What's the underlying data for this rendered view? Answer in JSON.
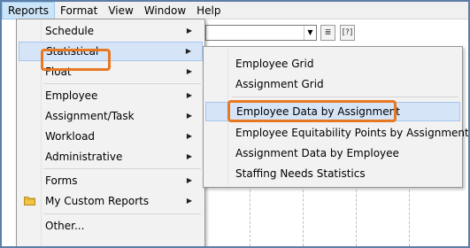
{
  "menubar": {
    "items": [
      "Reports",
      "Format",
      "View",
      "Window",
      "Help"
    ]
  },
  "reports_menu": {
    "items": [
      {
        "label": "Schedule",
        "submenu": true
      },
      {
        "label": "Statistical",
        "submenu": true
      },
      {
        "label": "Float",
        "submenu": true
      },
      {
        "label": "Employee",
        "submenu": true
      },
      {
        "label": "Assignment/Task",
        "submenu": true
      },
      {
        "label": "Workload",
        "submenu": true
      },
      {
        "label": "Administrative",
        "submenu": true
      },
      {
        "label": "Forms",
        "submenu": true
      },
      {
        "label": "My Custom Reports",
        "submenu": true,
        "icon": "folder-icon"
      },
      {
        "label": "Other...",
        "submenu": false
      }
    ],
    "selected": "Statistical",
    "arrow_glyph": "▶"
  },
  "statistical_submenu": {
    "items": [
      "Employee Grid",
      "Assignment Grid",
      "Employee Data by Assignment",
      "Employee Equitability Points by Assignment",
      "Assignment Data by Employee",
      "Staffing Needs Statistics"
    ],
    "selected": "Employee Data by Assignment"
  },
  "toolbar": {
    "combo_arrow": "▼",
    "btn1_glyph": "≣",
    "btn2_glyph": "[?]"
  },
  "colors": {
    "callout": "#e87722",
    "highlight": "#d5e5f7",
    "frame": "#5d7ea6"
  }
}
